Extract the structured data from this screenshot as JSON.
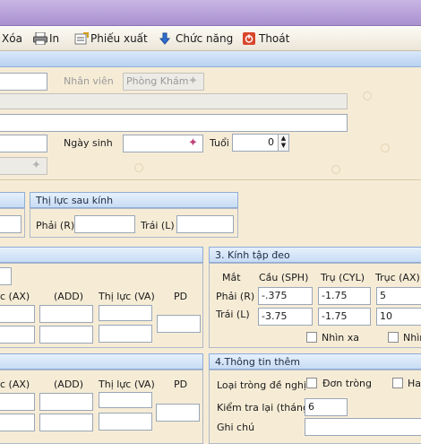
{
  "toolbar": {
    "delete": "Xóa",
    "print": "In",
    "voucher": "Phiếu xuất",
    "functions": "Chức năng",
    "exit": "Thoát"
  },
  "patient": {
    "staff_label": "Nhân viên",
    "staff_value": "Phòng Khám",
    "dob_label": "Ngày sinh",
    "age_label": "Tuổi",
    "age_value": "0"
  },
  "sections": {
    "vision_after": "Thị lực sau kính",
    "lenses": "3. Kính tập đeo",
    "extra": "4.Thông tin thêm"
  },
  "vision_after": {
    "right_label": "Phải (R)",
    "left_label": "Trái (L)"
  },
  "rx_left_headers": [
    "c (AX)",
    "(ADD)",
    "Thị lực (VA)",
    "PD"
  ],
  "lens": {
    "eye_label": "Mắt",
    "col_sph": "Cầu (SPH)",
    "col_cyl": "Trụ (CYL)",
    "col_ax": "Trục (AX)",
    "right_label": "Phải (R)",
    "left_label": "Trái (L)",
    "right_sph": "-.375",
    "right_cyl": "-1.75",
    "right_ax": "5",
    "left_sph": "-3.75",
    "left_cyl": "-1.75",
    "left_ax": "10",
    "near_label": "Nhìn xa",
    "near2_label": "Nhìn"
  },
  "extra": {
    "lens_type_label": "Loại tròng đề nghị",
    "single_label": "Đơn tròng",
    "bifocal_label": "Hai",
    "recheck_label": "Kiểm tra lại (tháng)",
    "recheck_value": "6",
    "note_label": "Ghi chú"
  },
  "colors": {
    "accent": "#c9b6e4",
    "panel": "#f6ecd6",
    "section_header": "#c7dcf4"
  }
}
